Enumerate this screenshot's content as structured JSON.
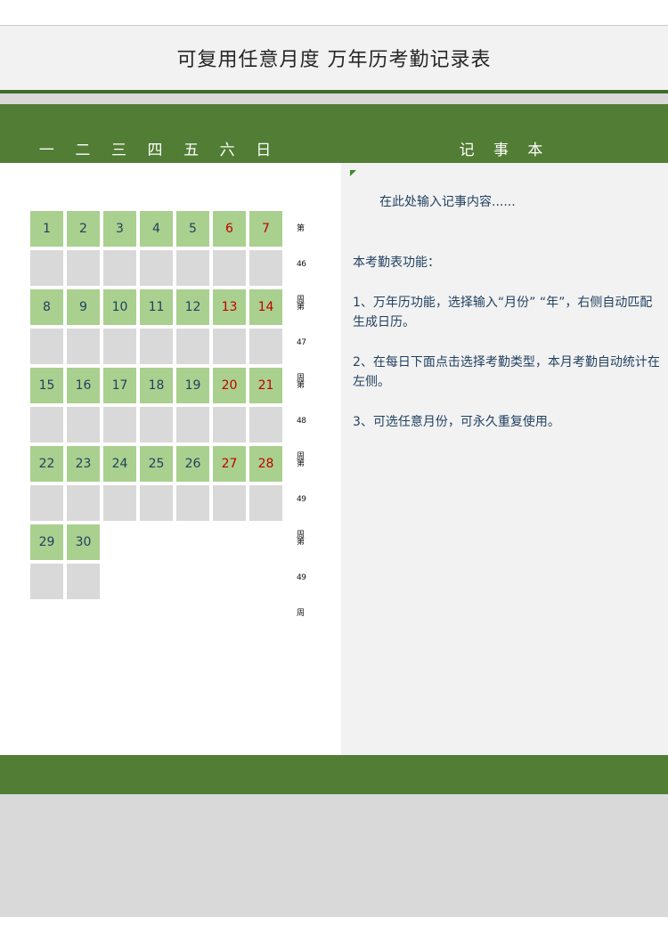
{
  "title": "可复用任意月度  万年历考勤记录表",
  "weekdays": [
    "一",
    "二",
    "三",
    "四",
    "五",
    "六",
    "日"
  ],
  "notes": {
    "title": "记 事 本",
    "placeholder": "在此处输入记事内容......",
    "features_heading": "本考勤表功能：",
    "feature_1": "1、万年历功能，选择输入“月份” “年”，右侧自动匹配生成日历。",
    "feature_2": "2、在每日下面点击选择考勤类型，本月考勤自动统计在左侧。",
    "feature_3": "3、可选任意月份，可永久重复使用。"
  },
  "calendar": {
    "weeks": [
      {
        "label": "第46周",
        "days": [
          "1",
          "2",
          "3",
          "4",
          "5",
          "6",
          "7"
        ]
      },
      {
        "label": "第47周",
        "days": [
          "8",
          "9",
          "10",
          "11",
          "12",
          "13",
          "14"
        ]
      },
      {
        "label": "第48周",
        "days": [
          "15",
          "16",
          "17",
          "18",
          "19",
          "20",
          "21"
        ]
      },
      {
        "label": "第49周",
        "days": [
          "22",
          "23",
          "24",
          "25",
          "26",
          "27",
          "28"
        ]
      },
      {
        "label": "第49周",
        "days": [
          "29",
          "30"
        ]
      }
    ]
  },
  "colors": {
    "accent_green": "#527d34",
    "day_cell": "#a9d08e",
    "weekend_text": "#c00000",
    "blank_cell": "#d9d9d9"
  }
}
